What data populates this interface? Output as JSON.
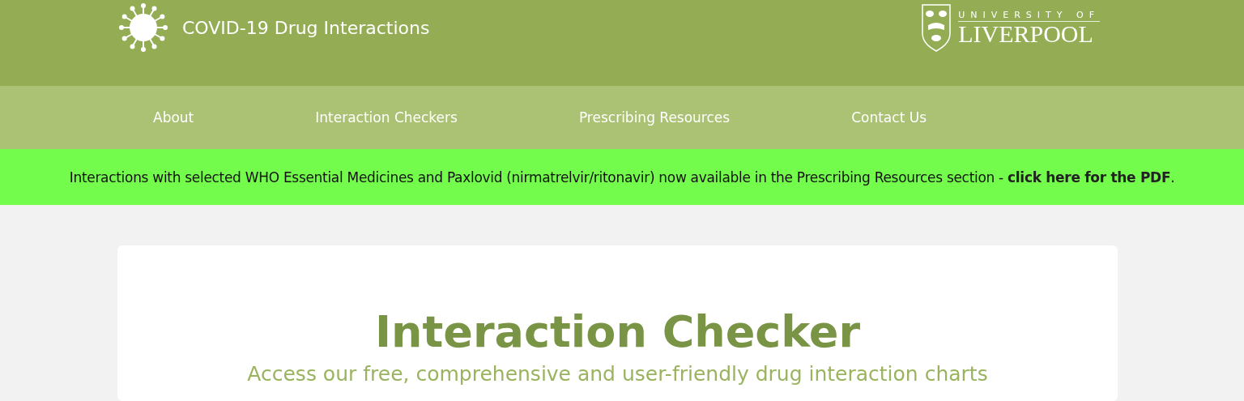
{
  "header": {
    "title": "COVID-19 Drug Interactions",
    "university": {
      "line_1": "UNIVERSITY OF",
      "line_2": "LIVERPOOL"
    }
  },
  "nav": [
    {
      "label": "About"
    },
    {
      "label": "Interaction Checkers"
    },
    {
      "label": "Prescribing Resources"
    },
    {
      "label": "Contact Us"
    }
  ],
  "announcement": {
    "text": "Interactions with selected WHO Essential Medicines and Paxlovid (nirmatrelvir/ritonavir) now available in the Prescribing Resources section - ",
    "link": "click here for the PDF",
    "end": "."
  },
  "card": {
    "title": "Interaction Checker",
    "subtitle": "Access our free, comprehensive and user-friendly drug interaction charts"
  }
}
